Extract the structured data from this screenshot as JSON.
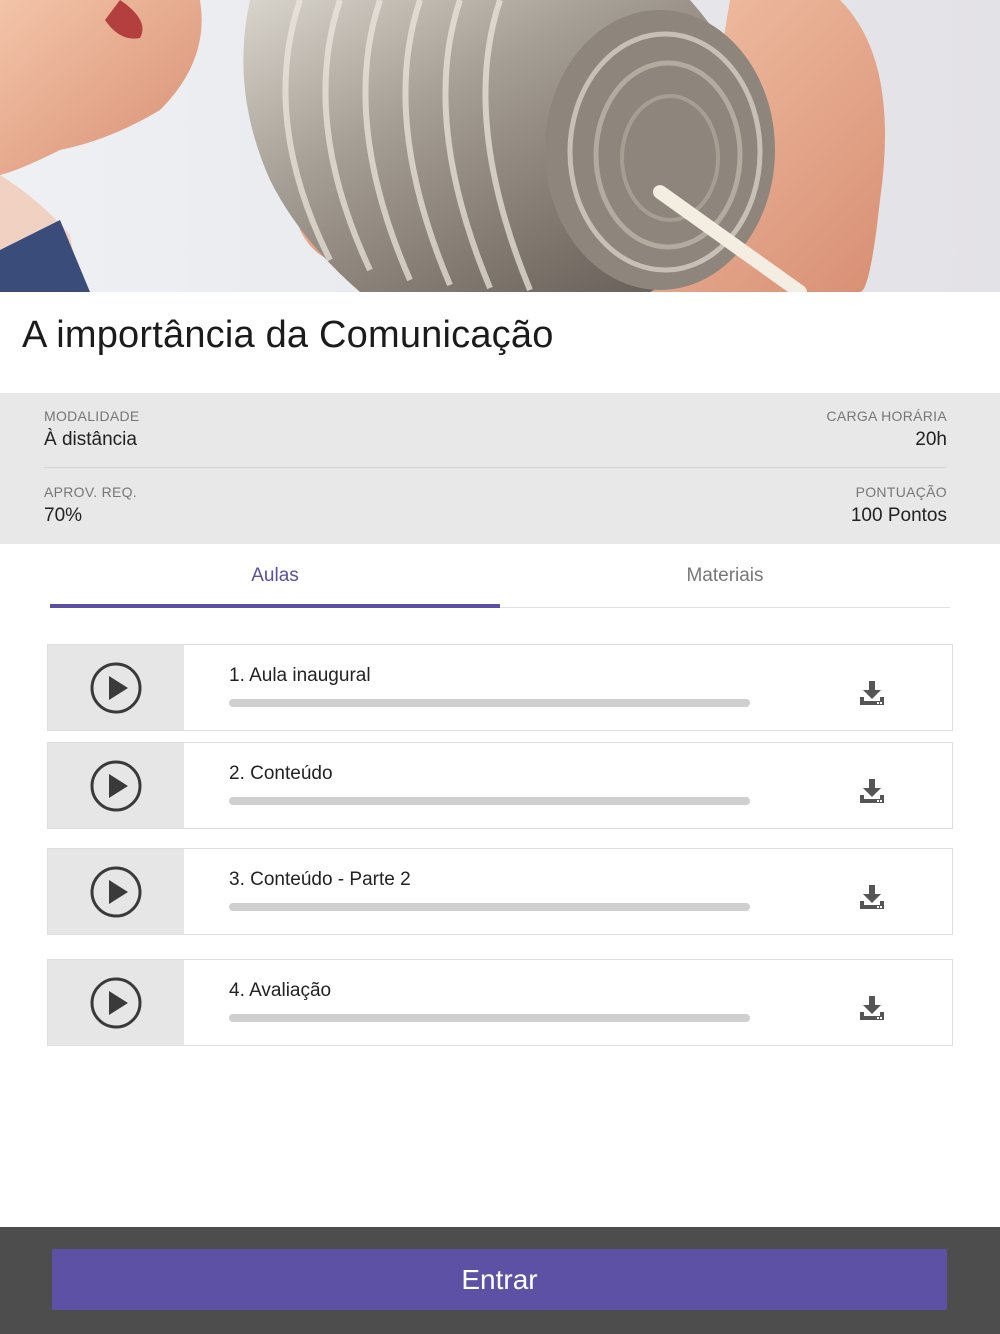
{
  "course": {
    "title": "A importância da Comunicação",
    "hero_image": "tin-can-phone-photo"
  },
  "info": {
    "modalidade": {
      "label": "MODALIDADE",
      "value": "À distância"
    },
    "carga_horaria": {
      "label": "CARGA HORÁRIA",
      "value": "20h"
    },
    "aprov_req": {
      "label": "APROV. REQ.",
      "value": "70%"
    },
    "pontuacao": {
      "label": "PONTUAÇÃO",
      "value": "100 Pontos"
    }
  },
  "tabs": [
    {
      "label": "Aulas",
      "active": true
    },
    {
      "label": "Materiais",
      "active": false
    }
  ],
  "lessons": [
    {
      "title": "1. Aula inaugural",
      "progress": 0
    },
    {
      "title": "2. Conteúdo",
      "progress": 0
    },
    {
      "title": "3. Conteúdo - Parte 2",
      "progress": 0
    },
    {
      "title": "4. Avaliação",
      "progress": 0
    }
  ],
  "icons": {
    "play": "play-circle-icon",
    "download": "download-icon"
  },
  "footer": {
    "button_label": "Entrar"
  },
  "colors": {
    "accent": "#5b4fa3",
    "button": "#5d51a5",
    "footer_bg": "#4d4d4d",
    "info_bg": "#e8e8e8"
  }
}
